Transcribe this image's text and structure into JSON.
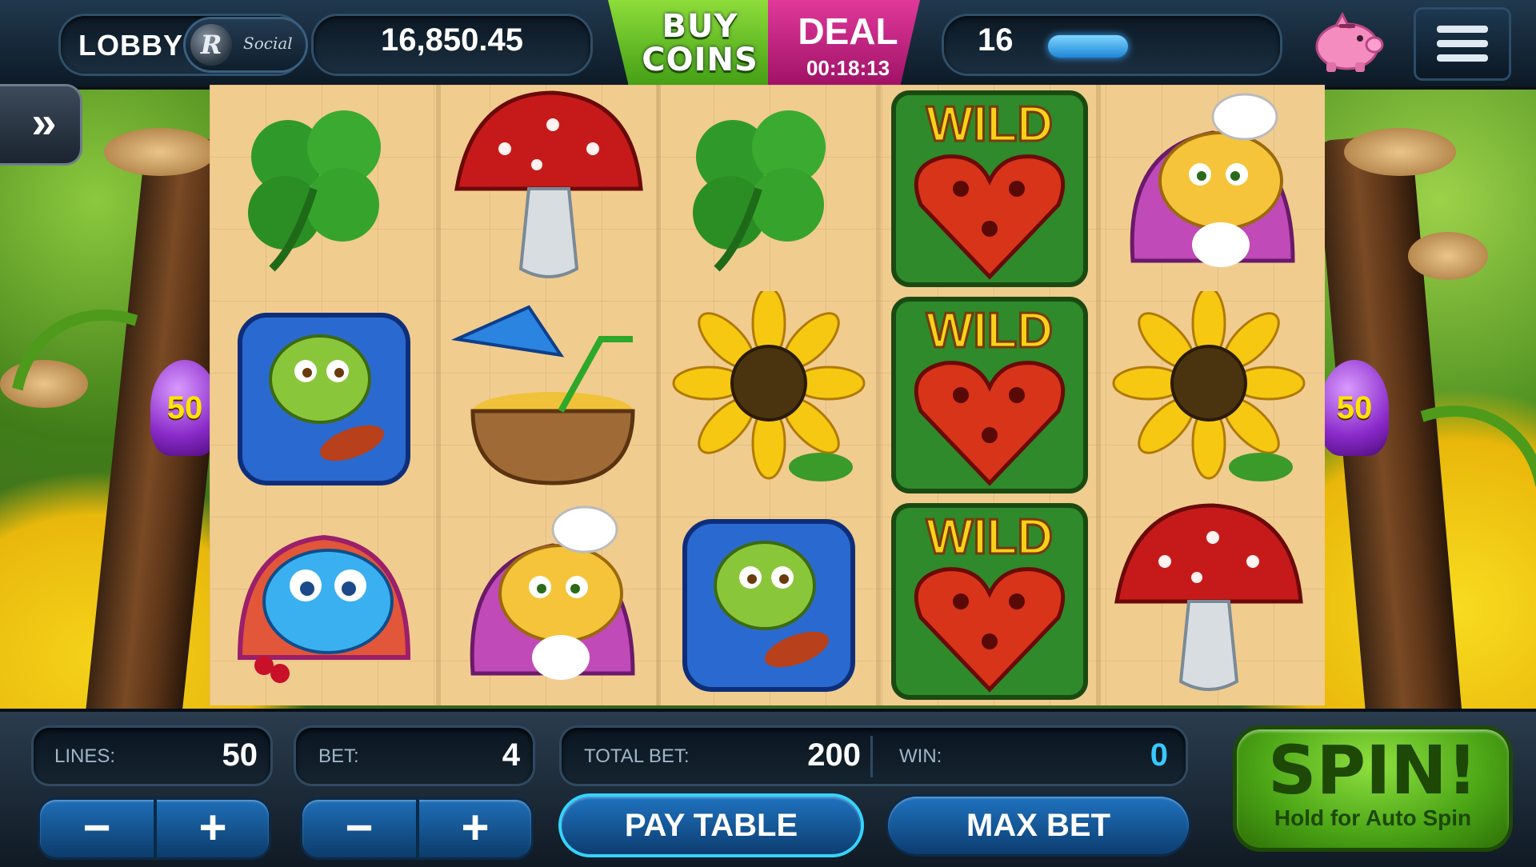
{
  "topbar": {
    "lobby": "LOBBY",
    "logo_letter": "R",
    "logo_text": "Social",
    "coin_balance": "16,850.45",
    "buy_coins": [
      "BUY",
      "COINS"
    ],
    "deal_label": "DEAL",
    "deal_timer": "00:18:13",
    "level": "16",
    "xp_progress": 0.1,
    "icons": [
      "piggy-bank-icon",
      "menu-icon"
    ]
  },
  "fast_forward_label": "»",
  "reels": [
    [
      "clover",
      "grasshopper-violin",
      "blue-bug-cherries"
    ],
    [
      "red-mushroom",
      "coconut-drink",
      "chef-caterpillar"
    ],
    [
      "clover",
      "sunflower",
      "grasshopper-violin"
    ],
    [
      "wild-heart",
      "wild-heart",
      "wild-heart"
    ],
    [
      "chef-caterpillar",
      "sunflower",
      "red-mushroom"
    ]
  ],
  "wild_text": "WILD",
  "lines_badge_left": "50",
  "lines_badge_right": "50",
  "controls": {
    "lines_label": "LINES:",
    "lines_value": "50",
    "bet_label": "BET:",
    "bet_value": "4",
    "total_bet_label": "TOTAL BET:",
    "total_bet_value": "200",
    "win_label": "WIN:",
    "win_value": "0",
    "minus": "−",
    "plus": "+",
    "pay_table": "PAY TABLE",
    "max_bet": "MAX BET",
    "spin": "SPIN!",
    "spin_sub": "Hold for Auto Spin"
  },
  "colors": {
    "win_value": "#36c9ff",
    "spin_green": "#4aa415",
    "deal_pink": "#c61f82",
    "buy_green": "#5cb726"
  }
}
